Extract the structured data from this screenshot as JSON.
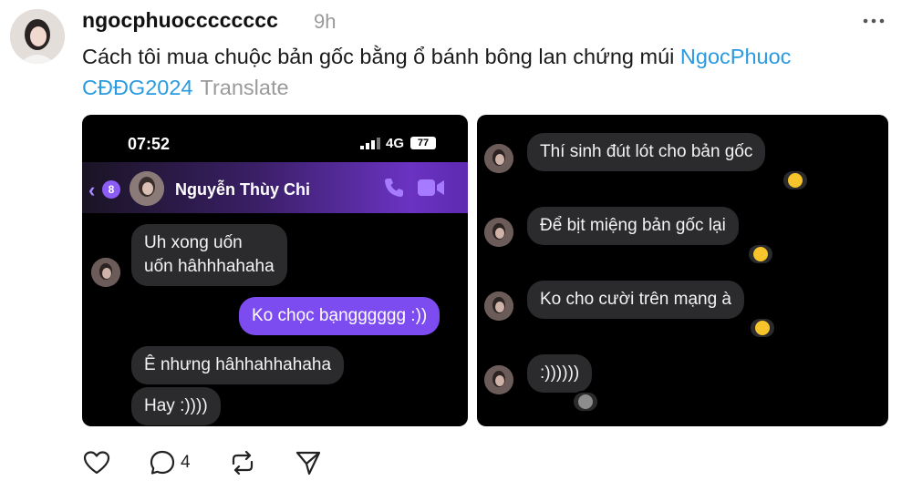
{
  "post": {
    "username": "ngocphuocccccccc",
    "time": "9h",
    "caption": "Cách tôi mua chuộc bản gốc bằng ổ bánh bông lan chứng múi",
    "tag_line1": "NgocPhuoc",
    "tag_line2": "CĐĐG2024",
    "translate": "Translate"
  },
  "shot1": {
    "status": {
      "clock": "07:52",
      "network": "4G",
      "battery": "77"
    },
    "header": {
      "back_count": "8",
      "contact_name": "Nguyễn Thùy Chi"
    },
    "messages": [
      {
        "text_l1": "Uh xong uốn",
        "text_l2": "uốn hâhhhahaha"
      },
      {
        "text": "Ko chọc bạngggggg :))"
      },
      {
        "text": "Ê nhưng hâhhahhahaha"
      },
      {
        "text": "Hay :))))"
      }
    ]
  },
  "shot2": {
    "messages": [
      {
        "text": "Thí sinh đút lót cho bản gốc"
      },
      {
        "text": "Để bịt miệng bản gốc lại"
      },
      {
        "text": "Ko cho cười trên mạng à"
      },
      {
        "text": ":))))))"
      }
    ]
  },
  "actions": {
    "comment_count": "4"
  },
  "colors": {
    "link": "#2a9be0",
    "sent_bubble": "#7d4cf0",
    "received_bubble": "#2b2b2e",
    "header_purple": "#6a33c2"
  },
  "icons": [
    "more-icon",
    "phone-icon",
    "video-icon",
    "heart-icon",
    "comment-icon",
    "repost-icon",
    "share-icon"
  ]
}
